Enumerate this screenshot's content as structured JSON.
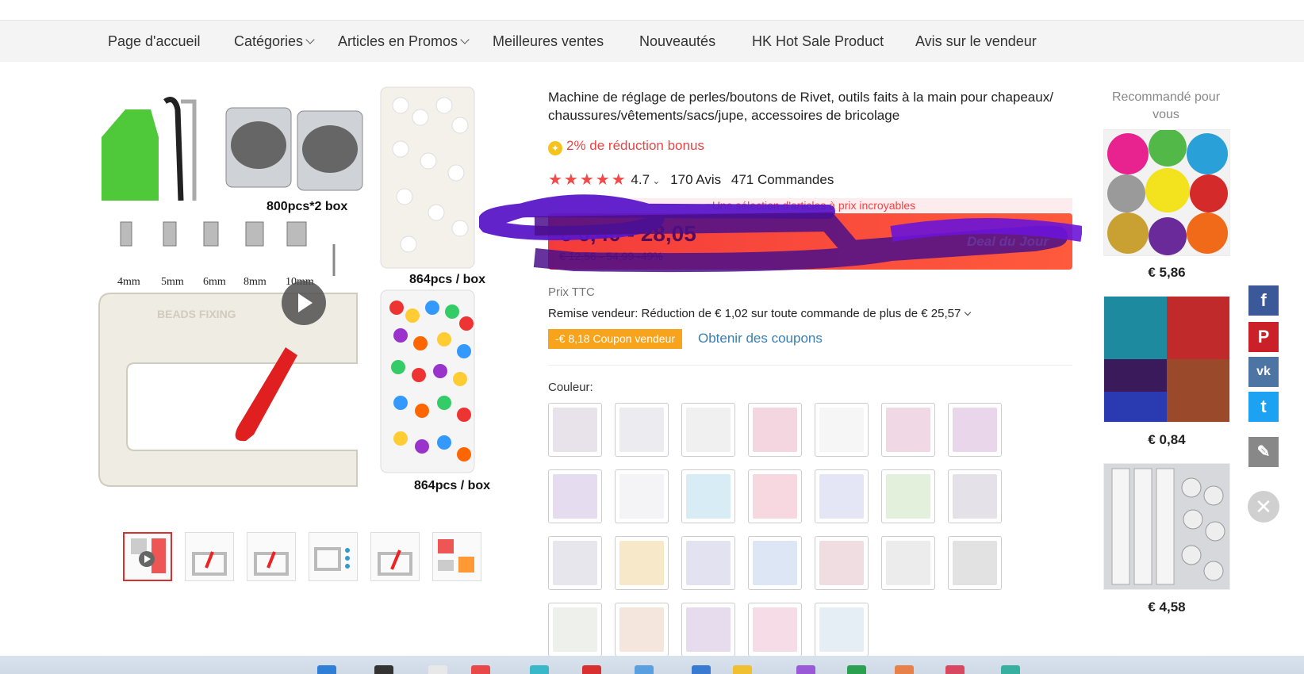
{
  "nav": {
    "items": [
      "Page d'accueil",
      "Catégories",
      "Articles en Promos",
      "Meilleures ventes",
      "Nouveautés",
      "HK Hot Sale Product",
      "Avis sur le vendeur"
    ]
  },
  "gallery": {
    "captions": [
      "800pcs*2 box",
      "864pcs / box",
      "864pcs / box"
    ],
    "sizes": [
      "4mm",
      "5mm",
      "6mm",
      "8mm",
      "10mm"
    ],
    "tool_label": "BEADS FIXING"
  },
  "product": {
    "title": "Machine de réglage de perles/boutons de Rivet, outils faits à la main pour chapeaux/ chaussures/vêtements/sacs/jupe, accessoires de bricolage",
    "bonus": "2% de réduction bonus",
    "rating_value": "4.7",
    "reviews": "170 Avis",
    "orders": "471 Commandes",
    "deal_banner": "Une sélection d'articles à prix incroyables",
    "price_range": "€ 6,40 - 28,05",
    "price_old": "€ 12,56 - 54,99  -49%",
    "deal_label": "Deal du Jour",
    "prix_ttc": "Prix TTC",
    "remise": "Remise vendeur: Réduction de € 1,02 sur toute commande de plus de € 25,57",
    "coupon_badge": "-€ 8,18 Coupon vendeur",
    "coupon_link": "Obtenir des coupons",
    "couleur_label": "Couleur:"
  },
  "recommended": {
    "title": "Recommandé pour vous",
    "prices": [
      "€ 5,86",
      "€ 0,84",
      "€ 4,58"
    ]
  },
  "share": {
    "icons": [
      "facebook-icon",
      "pinterest-icon",
      "vk-icon",
      "twitter-icon",
      "edit-icon",
      "close-icon"
    ],
    "glyphs": [
      "f",
      "P",
      "vk",
      "t",
      "✎",
      "✕"
    ]
  }
}
